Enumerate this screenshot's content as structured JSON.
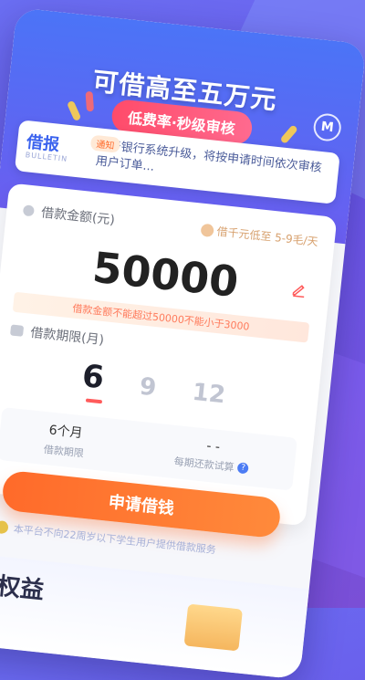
{
  "hero": {
    "title": "可借高至五万元",
    "pill": "低费率·秒级审核",
    "logo_icon": "brand-logo-icon"
  },
  "notice": {
    "badge_main": "借报",
    "badge_sub": "BULLETIN",
    "tag": "通知",
    "text": "由于银行系统升级，将按申请时间依次审核用户订单..."
  },
  "loan": {
    "amount_label": "借款金额(元)",
    "rate_hint": "借千元低至 5-9毛/天",
    "amount": "50000",
    "limit_warning": "借款金额不能超过50000不能小于3000",
    "period_label": "借款期限(月)",
    "periods": [
      "6",
      "9",
      "12"
    ],
    "selected_period": "6"
  },
  "summary": {
    "term_value": "6个月",
    "term_label": "借款期限",
    "repay_value": "- -",
    "repay_label": "每期还款试算"
  },
  "actions": {
    "apply": "申请借钱"
  },
  "footer": {
    "disclaimer": "本平台不向22周岁以下学生用户提供借款服务",
    "banner_text": "专权益"
  },
  "colors": {
    "primary": "#4b74f7",
    "accent_orange": "#ff6a2a",
    "warning_text": "#ff7a5b"
  }
}
